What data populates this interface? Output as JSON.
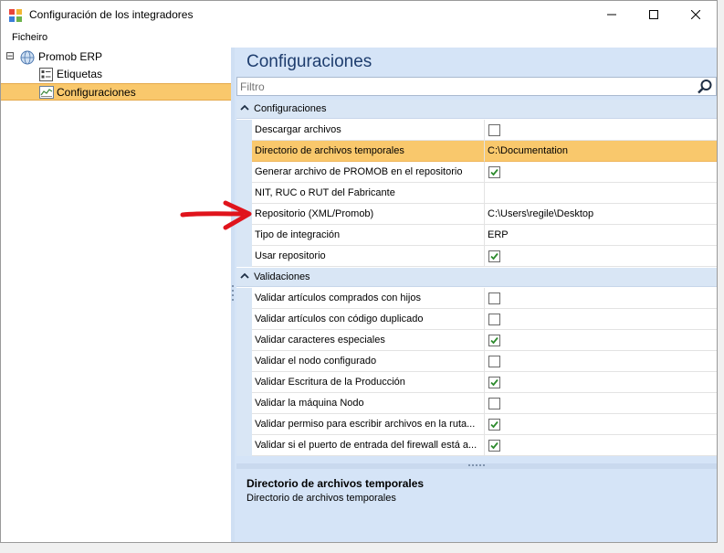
{
  "window": {
    "title": "Configuración de los integradores"
  },
  "menu": {
    "items": [
      "Ficheiro"
    ]
  },
  "tree": {
    "expander": "⊟",
    "root": "Promob ERP",
    "children": [
      "Etiquetas",
      "Configuraciones"
    ],
    "selected": "Configuraciones"
  },
  "panel": {
    "title": "Configuraciones",
    "filter_placeholder": "Filtro"
  },
  "grid": {
    "categories": [
      {
        "name": "Configuraciones",
        "rows": [
          {
            "name": "Descargar archivos",
            "type": "checkbox",
            "checked": false
          },
          {
            "name": "Directorio de archivos temporales",
            "type": "text",
            "value": "C:\\Documentation",
            "selected": true
          },
          {
            "name": "Generar archivo de PROMOB en el repositorio",
            "type": "checkbox",
            "checked": true
          },
          {
            "name": "NIT, RUC o RUT del Fabricante",
            "type": "text",
            "value": ""
          },
          {
            "name": "Repositorio (XML/Promob)",
            "type": "text",
            "value": "C:\\Users\\regile\\Desktop"
          },
          {
            "name": "Tipo de integración",
            "type": "text",
            "value": "ERP"
          },
          {
            "name": "Usar repositorio",
            "type": "checkbox",
            "checked": true
          }
        ]
      },
      {
        "name": "Validaciones",
        "rows": [
          {
            "name": "Validar artículos comprados con hijos",
            "type": "checkbox",
            "checked": false
          },
          {
            "name": "Validar artículos con código duplicado",
            "type": "checkbox",
            "checked": false
          },
          {
            "name": "Validar caracteres especiales",
            "type": "checkbox",
            "checked": true
          },
          {
            "name": "Validar el nodo configurado",
            "type": "checkbox",
            "checked": false
          },
          {
            "name": "Validar Escritura de la Producción",
            "type": "checkbox",
            "checked": true
          },
          {
            "name": "Validar la máquina Nodo",
            "type": "checkbox",
            "checked": false
          },
          {
            "name": "Validar permiso para escribir archivos en la ruta...",
            "type": "checkbox",
            "checked": true
          },
          {
            "name": "Validar si el puerto de entrada del firewall está a...",
            "type": "checkbox",
            "checked": true
          }
        ]
      }
    ]
  },
  "description": {
    "title": "Directorio de archivos temporales",
    "text": "Directorio de archivos temporales"
  },
  "colors": {
    "selection": "#f9c86c",
    "panel_bg": "#d5e4f7",
    "category_bg": "#d9e6f5",
    "check_green": "#2e8b2e",
    "annotation_arrow": "#e0141c"
  }
}
